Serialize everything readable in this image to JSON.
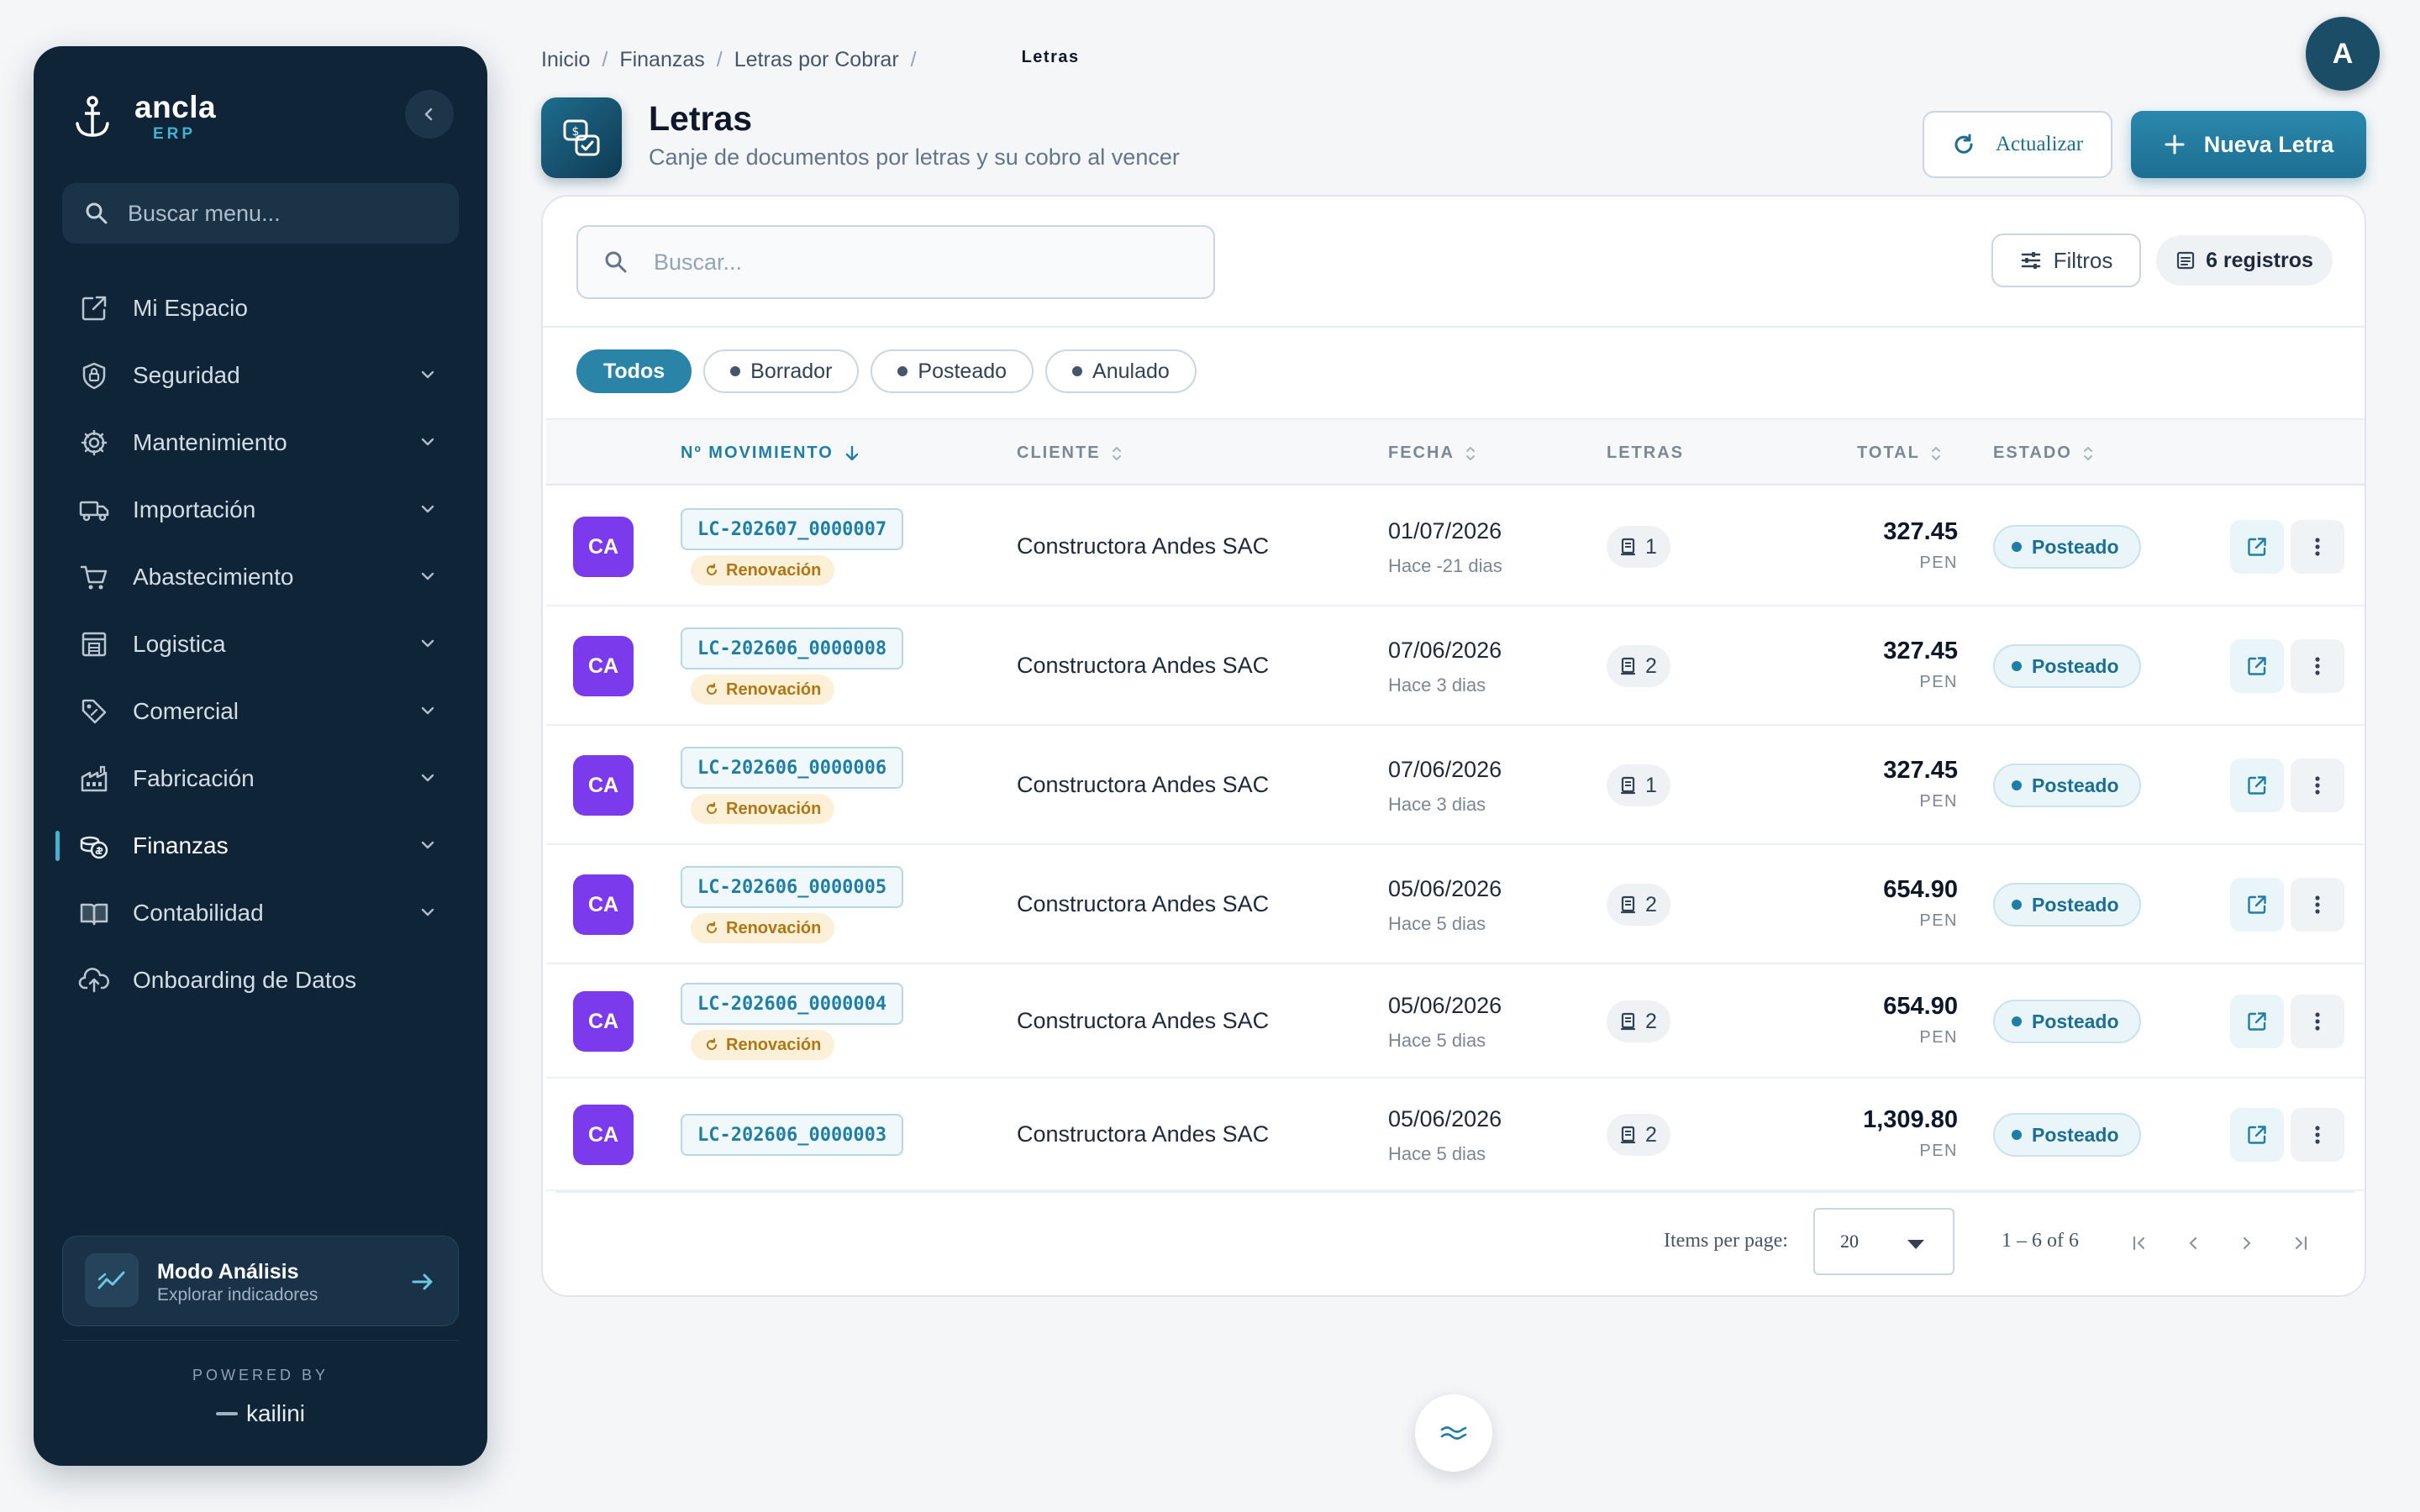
{
  "brand": {
    "name": "ancla",
    "sub": "ERP",
    "powered_by": "POWERED BY",
    "powered_brand": "kailini"
  },
  "sidebar": {
    "search_placeholder": "Buscar menu...",
    "items": [
      {
        "label": "Mi Espacio",
        "icon": "external-square-icon",
        "expandable": false
      },
      {
        "label": "Seguridad",
        "icon": "shield-icon",
        "expandable": true
      },
      {
        "label": "Mantenimiento",
        "icon": "gear-icon",
        "expandable": true
      },
      {
        "label": "Importación",
        "icon": "truck-icon",
        "expandable": true
      },
      {
        "label": "Abastecimiento",
        "icon": "cart-icon",
        "expandable": true
      },
      {
        "label": "Logistica",
        "icon": "warehouse-icon",
        "expandable": true
      },
      {
        "label": "Comercial",
        "icon": "tag-icon",
        "expandable": true
      },
      {
        "label": "Fabricación",
        "icon": "factory-icon",
        "expandable": true
      },
      {
        "label": "Finanzas",
        "icon": "coins-icon",
        "expandable": true,
        "active": true
      },
      {
        "label": "Contabilidad",
        "icon": "book-icon",
        "expandable": true
      },
      {
        "label": "Onboarding de Datos",
        "icon": "cloud-upload-icon",
        "expandable": false
      }
    ],
    "analysis": {
      "title": "Modo Análisis",
      "subtitle": "Explorar indicadores"
    }
  },
  "breadcrumb": [
    "Inicio",
    "Finanzas",
    "Letras por Cobrar",
    "Letras"
  ],
  "user": {
    "initial": "A"
  },
  "header": {
    "title": "Letras",
    "subtitle": "Canje de documentos por letras y su cobro al vencer",
    "refresh_label": "Actualizar",
    "new_label": "Nueva Letra"
  },
  "toolbar": {
    "search_placeholder": "Buscar...",
    "filters_label": "Filtros",
    "count_label": "6 registros"
  },
  "status_chips": [
    "Todos",
    "Borrador",
    "Posteado",
    "Anulado"
  ],
  "table": {
    "columns": [
      "Nº MOVIMIENTO",
      "CLIENTE",
      "FECHA",
      "LETRAS",
      "TOTAL",
      "ESTADO"
    ],
    "rows": [
      {
        "avatar": "CA",
        "code": "LC-202607_0000007",
        "tag": "Renovación",
        "client": "Constructora Andes SAC",
        "date": "01/07/2026",
        "ago": "Hace -21 dias",
        "letras": "1",
        "total": "327.45",
        "currency": "PEN",
        "status": "Posteado"
      },
      {
        "avatar": "CA",
        "code": "LC-202606_0000008",
        "tag": "Renovación",
        "client": "Constructora Andes SAC",
        "date": "07/06/2026",
        "ago": "Hace 3 dias",
        "letras": "2",
        "total": "327.45",
        "currency": "PEN",
        "status": "Posteado"
      },
      {
        "avatar": "CA",
        "code": "LC-202606_0000006",
        "tag": "Renovación",
        "client": "Constructora Andes SAC",
        "date": "07/06/2026",
        "ago": "Hace 3 dias",
        "letras": "1",
        "total": "327.45",
        "currency": "PEN",
        "status": "Posteado"
      },
      {
        "avatar": "CA",
        "code": "LC-202606_0000005",
        "tag": "Renovación",
        "client": "Constructora Andes SAC",
        "date": "05/06/2026",
        "ago": "Hace 5 dias",
        "letras": "2",
        "total": "654.90",
        "currency": "PEN",
        "status": "Posteado"
      },
      {
        "avatar": "CA",
        "code": "LC-202606_0000004",
        "tag": "Renovación",
        "client": "Constructora Andes SAC",
        "date": "05/06/2026",
        "ago": "Hace 5 dias",
        "letras": "2",
        "total": "654.90",
        "currency": "PEN",
        "status": "Posteado"
      },
      {
        "avatar": "CA",
        "code": "LC-202606_0000003",
        "tag": "",
        "client": "Constructora Andes SAC",
        "date": "05/06/2026",
        "ago": "Hace 5 dias",
        "letras": "2",
        "total": "1,309.80",
        "currency": "PEN",
        "status": "Posteado"
      }
    ]
  },
  "pagination": {
    "items_per_page_label": "Items per page:",
    "page_size": "20",
    "range": "1 – 6 of 6"
  },
  "colors": {
    "sidebar_bg": "#0f2436",
    "accent": "#2a84a8",
    "avatar": "#7c3aed",
    "tag_bg": "#fdf0d8"
  }
}
